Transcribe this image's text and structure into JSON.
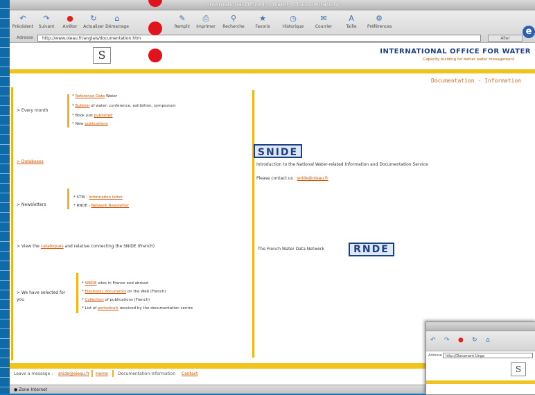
{
  "window": {
    "title": "International Office for Water - Documentation"
  },
  "toolbar": {
    "buttons": [
      {
        "label": "Précédent",
        "icon": "back-arrow-icon"
      },
      {
        "label": "Suivant",
        "icon": "forward-arrow-icon"
      },
      {
        "label": "Arrêter",
        "icon": "stop-icon"
      },
      {
        "label": "Actualiser",
        "icon": "refresh-icon"
      },
      {
        "label": "Démarrage",
        "icon": "home-icon"
      },
      {
        "label": "Remplir",
        "icon": "autofill-icon"
      },
      {
        "label": "Imprimer",
        "icon": "print-icon"
      },
      {
        "label": "Recherche",
        "icon": "search-icon"
      },
      {
        "label": "Favoris",
        "icon": "favorites-icon"
      },
      {
        "label": "Historique",
        "icon": "history-icon"
      },
      {
        "label": "Courrier",
        "icon": "mail-icon"
      },
      {
        "label": "Taille",
        "icon": "text-size-icon"
      },
      {
        "label": "Préférences",
        "icon": "preferences-icon"
      }
    ]
  },
  "address": {
    "label": "Adresse",
    "url": "http://www.oieau.fr/anglais/documentation.htm",
    "go_label": "Aller"
  },
  "header": {
    "org_name": "INTERNATIONAL OFFICE FOR WATER",
    "org_subtitle": "Capacity building for better water management",
    "logo_glyph": "S",
    "section_title": "Documentation - Information"
  },
  "left": {
    "every_month": {
      "label": "> Every month",
      "items": [
        {
          "link": "Reference Data",
          "text": " Water"
        },
        {
          "link": "Bulletin",
          "text": " of water: conference, exhibition, symposium"
        },
        {
          "text": "Book just ",
          "link": "published"
        },
        {
          "text": "New ",
          "link": "publications"
        }
      ]
    },
    "databases": {
      "label": "> Databases"
    },
    "newsletters": {
      "label": "> Newsletters",
      "items": [
        {
          "text": "STW - ",
          "link": "Information letter"
        },
        {
          "text": "RNDE - ",
          "link": "Network Newsletter"
        }
      ]
    },
    "catalogues": {
      "text1": "> View the ",
      "link": "catalogues",
      "text2": " and relative connecting the SNIDE (French)"
    },
    "selected": {
      "label": "> We have selected for you",
      "items": [
        {
          "link": "SNIDE",
          "text": " sites in France and abroad"
        },
        {
          "link": "Electronic documents",
          "text": " on the Web (French)"
        },
        {
          "link": "Collection",
          "text": " of publications (French)"
        },
        {
          "text": "List of ",
          "link": "periodicals",
          "text2": " received by the documentation centre"
        }
      ]
    }
  },
  "right": {
    "snide_logo": "SNIDE",
    "snide_intro": "Introduction to the National Water-related Information and Documentation Service",
    "contact_text": "Please contact us : ",
    "contact_link": "snide@oieau.fr",
    "rnde_text": "The French Water Data Network",
    "rnde_logo": "RNDE"
  },
  "footer": {
    "text1": "Leave a message : ",
    "link1": "snide@oieau.fr",
    "link2": "Home",
    "text2": "Documentation-Information",
    "link3": "Contact"
  },
  "status": {
    "text": "Zone Internet"
  },
  "second_window": {
    "address": "http://Document Unga"
  }
}
